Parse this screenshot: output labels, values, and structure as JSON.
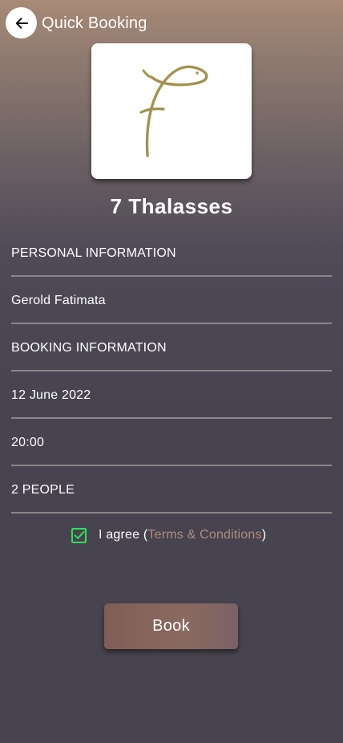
{
  "header": {
    "title": "Quick Booking",
    "back_icon": "arrow-left-icon"
  },
  "venue": {
    "name": "7 Thalasses",
    "logo_icon": "fish-f-logo",
    "logo_color": "#a39250"
  },
  "form": {
    "personal_section": "PERSONAL INFORMATION",
    "name_value": "Gerold Fatimata",
    "booking_section": "BOOKING INFORMATION",
    "date_value": "12 June 2022",
    "time_value": "20:00",
    "people_value": "2 PEOPLE"
  },
  "agreement": {
    "checked": true,
    "prefix": "I agree (",
    "terms_label": "Terms & Conditions",
    "suffix": ")",
    "check_color": "#2ee05a",
    "link_color": "#b08f79"
  },
  "actions": {
    "book_label": "Book"
  }
}
